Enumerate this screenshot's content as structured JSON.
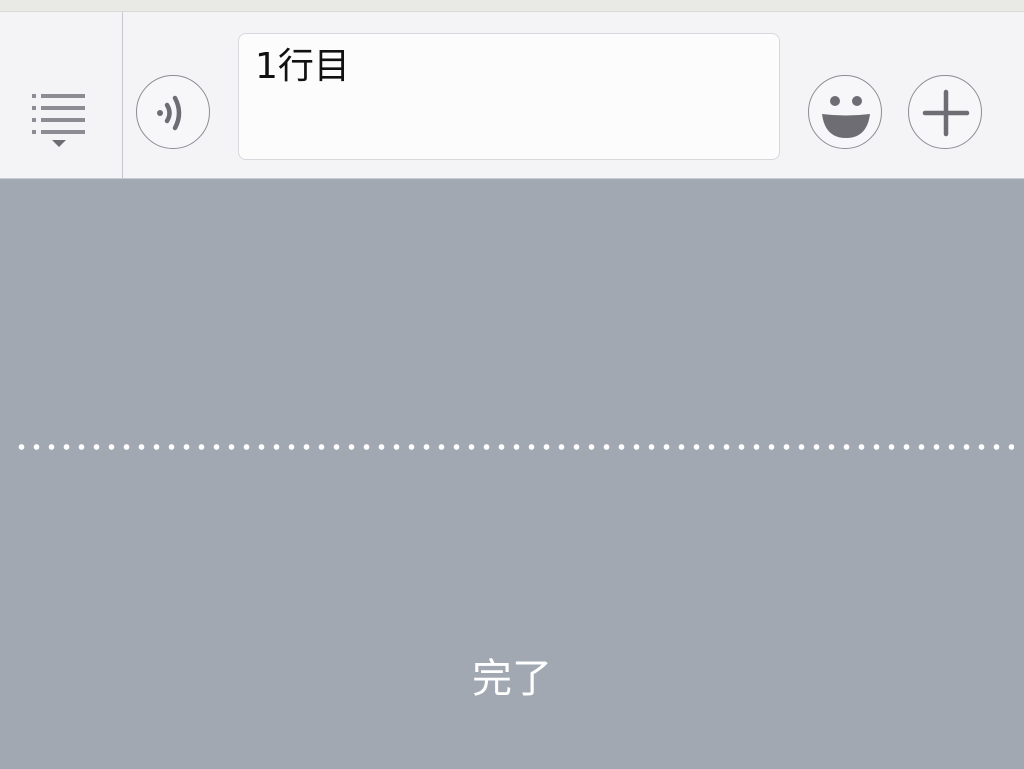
{
  "composer": {
    "text_value": "1行目"
  },
  "keyboard": {
    "done_label": "完了"
  },
  "icons": {
    "menu": "list-menu-icon",
    "voice": "voice-message-icon",
    "emoji": "smiley-emoji-icon",
    "plus": "plus-icon"
  },
  "colors": {
    "toolbar_bg": "#f4f4f6",
    "keyboard_bg": "#a2a8b2",
    "icon_gray": "#8c8c92",
    "done_text": "#ffffff"
  }
}
